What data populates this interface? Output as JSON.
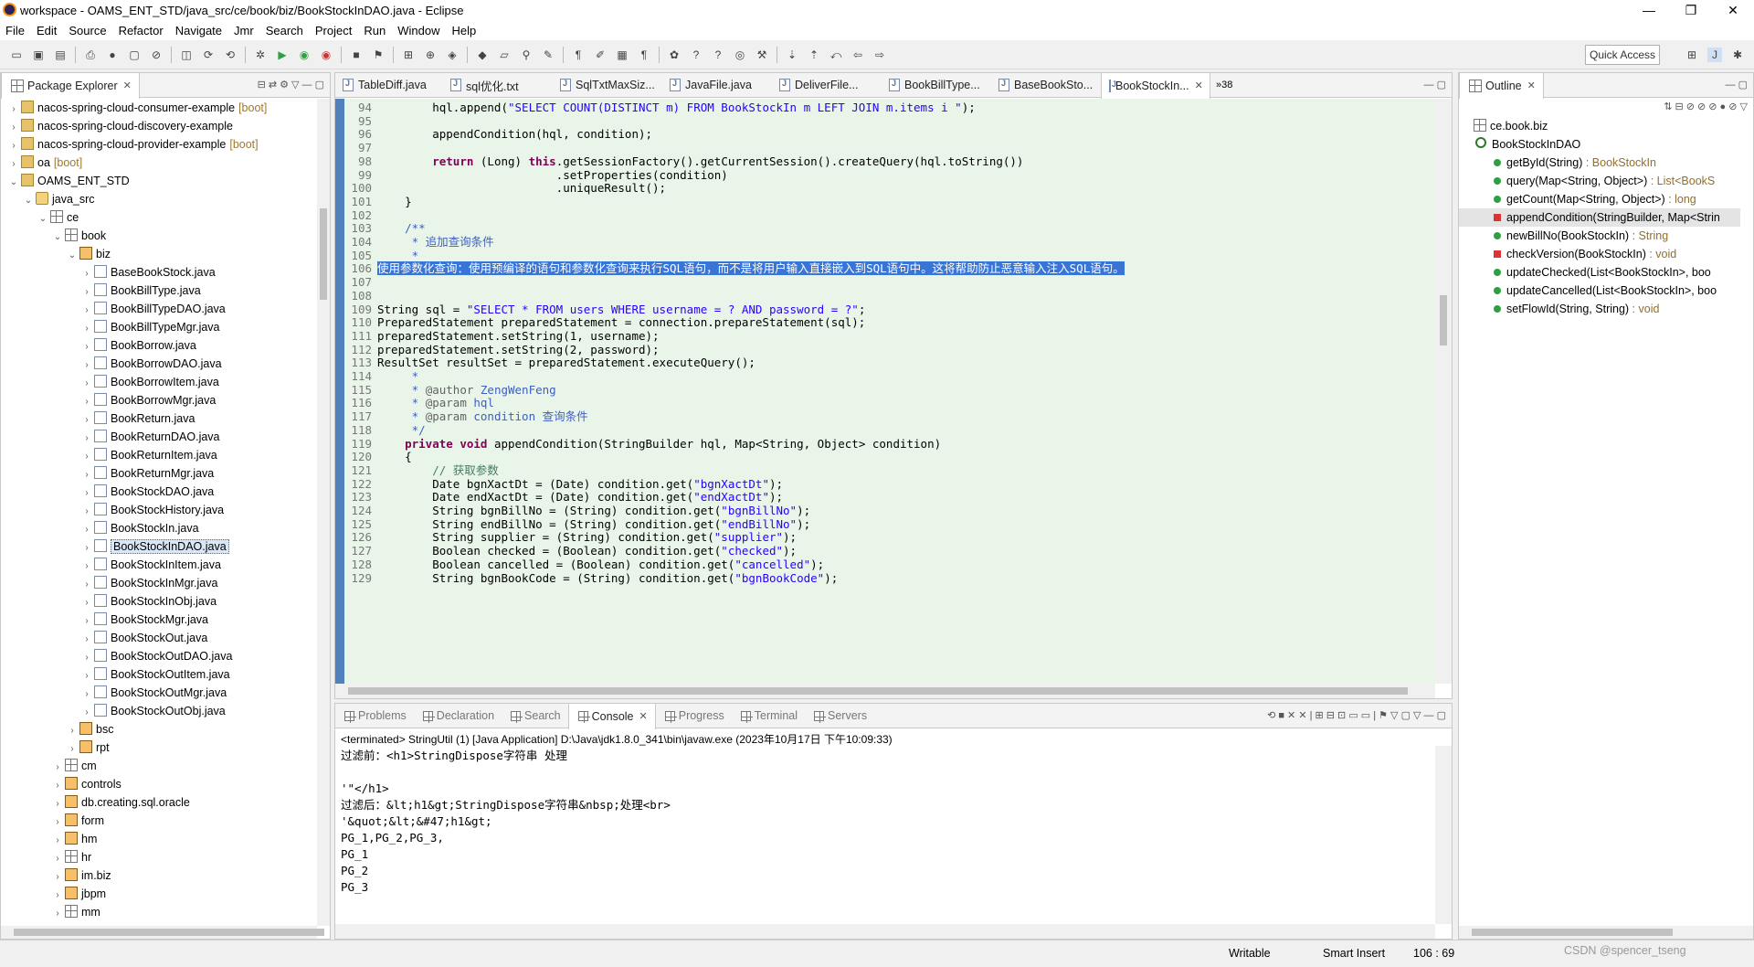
{
  "window": {
    "title": "workspace - OAMS_ENT_STD/java_src/ce/book/biz/BookStockInDAO.java - Eclipse",
    "controls": [
      "—",
      "❐",
      "✕"
    ]
  },
  "menu": [
    "File",
    "Edit",
    "Source",
    "Refactor",
    "Navigate",
    "Jmr",
    "Search",
    "Project",
    "Run",
    "Window",
    "Help"
  ],
  "toolbar": {
    "quick_access": "Quick Access"
  },
  "package_explorer": {
    "title": "Package Explorer",
    "rows": [
      {
        "label": "nacos-spring-cloud-consumer-example",
        "suffix": "[boot]",
        "depth": 0,
        "arrow": "›",
        "icon": "proj"
      },
      {
        "label": "nacos-spring-cloud-discovery-example",
        "suffix": "",
        "depth": 0,
        "arrow": "›",
        "icon": "proj"
      },
      {
        "label": "nacos-spring-cloud-provider-example",
        "suffix": "[boot]",
        "depth": 0,
        "arrow": "›",
        "icon": "proj"
      },
      {
        "label": "oa",
        "suffix": "[boot]",
        "depth": 0,
        "arrow": "›",
        "icon": "proj"
      },
      {
        "label": "OAMS_ENT_STD",
        "suffix": "",
        "depth": 0,
        "arrow": "⌄",
        "icon": "proj"
      },
      {
        "label": "java_src",
        "suffix": "",
        "depth": 1,
        "arrow": "⌄",
        "icon": "src"
      },
      {
        "label": "ce",
        "suffix": "",
        "depth": 2,
        "arrow": "⌄",
        "icon": "pk"
      },
      {
        "label": "book",
        "suffix": "",
        "depth": 3,
        "arrow": "⌄",
        "icon": "pk"
      },
      {
        "label": "biz",
        "suffix": "",
        "depth": 4,
        "arrow": "⌄",
        "icon": "pkb"
      },
      {
        "label": "BaseBookStock.java",
        "suffix": "",
        "depth": 5,
        "arrow": "›",
        "icon": "jf"
      },
      {
        "label": "BookBillType.java",
        "suffix": "",
        "depth": 5,
        "arrow": "›",
        "icon": "jf"
      },
      {
        "label": "BookBillTypeDAO.java",
        "suffix": "",
        "depth": 5,
        "arrow": "›",
        "icon": "jf"
      },
      {
        "label": "BookBillTypeMgr.java",
        "suffix": "",
        "depth": 5,
        "arrow": "›",
        "icon": "jf"
      },
      {
        "label": "BookBorrow.java",
        "suffix": "",
        "depth": 5,
        "arrow": "›",
        "icon": "jf"
      },
      {
        "label": "BookBorrowDAO.java",
        "suffix": "",
        "depth": 5,
        "arrow": "›",
        "icon": "jf"
      },
      {
        "label": "BookBorrowItem.java",
        "suffix": "",
        "depth": 5,
        "arrow": "›",
        "icon": "jf"
      },
      {
        "label": "BookBorrowMgr.java",
        "suffix": "",
        "depth": 5,
        "arrow": "›",
        "icon": "jf"
      },
      {
        "label": "BookReturn.java",
        "suffix": "",
        "depth": 5,
        "arrow": "›",
        "icon": "jf"
      },
      {
        "label": "BookReturnDAO.java",
        "suffix": "",
        "depth": 5,
        "arrow": "›",
        "icon": "jf"
      },
      {
        "label": "BookReturnItem.java",
        "suffix": "",
        "depth": 5,
        "arrow": "›",
        "icon": "jf"
      },
      {
        "label": "BookReturnMgr.java",
        "suffix": "",
        "depth": 5,
        "arrow": "›",
        "icon": "jf"
      },
      {
        "label": "BookStockDAO.java",
        "suffix": "",
        "depth": 5,
        "arrow": "›",
        "icon": "jf"
      },
      {
        "label": "BookStockHistory.java",
        "suffix": "",
        "depth": 5,
        "arrow": "›",
        "icon": "jf"
      },
      {
        "label": "BookStockIn.java",
        "suffix": "",
        "depth": 5,
        "arrow": "›",
        "icon": "jf"
      },
      {
        "label": "BookStockInDAO.java",
        "suffix": "",
        "depth": 5,
        "arrow": "›",
        "icon": "jf",
        "selected": true
      },
      {
        "label": "BookStockInItem.java",
        "suffix": "",
        "depth": 5,
        "arrow": "›",
        "icon": "jf"
      },
      {
        "label": "BookStockInMgr.java",
        "suffix": "",
        "depth": 5,
        "arrow": "›",
        "icon": "jf"
      },
      {
        "label": "BookStockInObj.java",
        "suffix": "",
        "depth": 5,
        "arrow": "›",
        "icon": "jf"
      },
      {
        "label": "BookStockMgr.java",
        "suffix": "",
        "depth": 5,
        "arrow": "›",
        "icon": "jf"
      },
      {
        "label": "BookStockOut.java",
        "suffix": "",
        "depth": 5,
        "arrow": "›",
        "icon": "jf"
      },
      {
        "label": "BookStockOutDAO.java",
        "suffix": "",
        "depth": 5,
        "arrow": "›",
        "icon": "jf"
      },
      {
        "label": "BookStockOutItem.java",
        "suffix": "",
        "depth": 5,
        "arrow": "›",
        "icon": "jf"
      },
      {
        "label": "BookStockOutMgr.java",
        "suffix": "",
        "depth": 5,
        "arrow": "›",
        "icon": "jf"
      },
      {
        "label": "BookStockOutObj.java",
        "suffix": "",
        "depth": 5,
        "arrow": "›",
        "icon": "jf"
      },
      {
        "label": "bsc",
        "suffix": "",
        "depth": 4,
        "arrow": "›",
        "icon": "pkb"
      },
      {
        "label": "rpt",
        "suffix": "",
        "depth": 4,
        "arrow": "›",
        "icon": "pkb"
      },
      {
        "label": "cm",
        "suffix": "",
        "depth": 3,
        "arrow": "›",
        "icon": "pk"
      },
      {
        "label": "controls",
        "suffix": "",
        "depth": 3,
        "arrow": "›",
        "icon": "pkb"
      },
      {
        "label": "db.creating.sql.oracle",
        "suffix": "",
        "depth": 3,
        "arrow": "›",
        "icon": "pkb"
      },
      {
        "label": "form",
        "suffix": "",
        "depth": 3,
        "arrow": "›",
        "icon": "pkb"
      },
      {
        "label": "hm",
        "suffix": "",
        "depth": 3,
        "arrow": "›",
        "icon": "pkb"
      },
      {
        "label": "hr",
        "suffix": "",
        "depth": 3,
        "arrow": "›",
        "icon": "pk"
      },
      {
        "label": "im.biz",
        "suffix": "",
        "depth": 3,
        "arrow": "›",
        "icon": "pkb"
      },
      {
        "label": "jbpm",
        "suffix": "",
        "depth": 3,
        "arrow": "›",
        "icon": "pkb"
      },
      {
        "label": "mm",
        "suffix": "",
        "depth": 3,
        "arrow": "›",
        "icon": "pk"
      }
    ]
  },
  "editor": {
    "tabs": [
      "TableDiff.java",
      "sql优化.txt",
      "SqlTxtMaxSiz...",
      "JavaFile.java",
      "DeliverFile...",
      "BookBillType...",
      "BaseBookSto...",
      "BookStockIn..."
    ],
    "active_tab": "BookStockIn...",
    "overflow": "»38",
    "lines": [
      {
        "n": "94",
        "t": "        hql.append(\"SELECT COUNT(DISTINCT m) FROM BookStockIn m LEFT JOIN m.items i \");"
      },
      {
        "n": "95",
        "t": ""
      },
      {
        "n": "96",
        "t": "        appendCondition(hql, condition);"
      },
      {
        "n": "97",
        "t": ""
      },
      {
        "n": "98",
        "t": "        return (Long) this.getSessionFactory().getCurrentSession().createQuery(hql.toString())"
      },
      {
        "n": "99",
        "t": "                          .setProperties(condition)"
      },
      {
        "n": "100",
        "t": "                          .uniqueResult();"
      },
      {
        "n": "101",
        "t": "    }"
      },
      {
        "n": "102",
        "t": ""
      },
      {
        "n": "103",
        "t": "    /**"
      },
      {
        "n": "104",
        "t": "     * 追加查询条件"
      },
      {
        "n": "105",
        "t": "     *"
      },
      {
        "n": "106",
        "t": "使用参数化查询：使用预编译的语句和参数化查询来执行SQL语句，而不是将用户输入直接嵌入到SQL语句中。这将帮助防止恶意输入注入SQL语句。",
        "hl": true
      },
      {
        "n": "107",
        "t": ""
      },
      {
        "n": "108",
        "t": ""
      },
      {
        "n": "109",
        "t": "String sql = \"SELECT * FROM users WHERE username = ? AND password = ?\";"
      },
      {
        "n": "110",
        "t": "PreparedStatement preparedStatement = connection.prepareStatement(sql);"
      },
      {
        "n": "111",
        "t": "preparedStatement.setString(1, username);"
      },
      {
        "n": "112",
        "t": "preparedStatement.setString(2, password);"
      },
      {
        "n": "113",
        "t": "ResultSet resultSet = preparedStatement.executeQuery();"
      },
      {
        "n": "114",
        "t": "     *"
      },
      {
        "n": "115",
        "t": "     * @author ZengWenFeng"
      },
      {
        "n": "116",
        "t": "     * @param hql"
      },
      {
        "n": "117",
        "t": "     * @param condition 查询条件"
      },
      {
        "n": "118",
        "t": "     */"
      },
      {
        "n": "119",
        "t": "    private void appendCondition(StringBuilder hql, Map<String, Object> condition)"
      },
      {
        "n": "120",
        "t": "    {"
      },
      {
        "n": "121",
        "t": "        // 获取参数"
      },
      {
        "n": "122",
        "t": "        Date bgnXactDt = (Date) condition.get(\"bgnXactDt\");"
      },
      {
        "n": "123",
        "t": "        Date endXactDt = (Date) condition.get(\"endXactDt\");"
      },
      {
        "n": "124",
        "t": "        String bgnBillNo = (String) condition.get(\"bgnBillNo\");"
      },
      {
        "n": "125",
        "t": "        String endBillNo = (String) condition.get(\"endBillNo\");"
      },
      {
        "n": "126",
        "t": "        String supplier = (String) condition.get(\"supplier\");"
      },
      {
        "n": "127",
        "t": "        Boolean checked = (Boolean) condition.get(\"checked\");"
      },
      {
        "n": "128",
        "t": "        Boolean cancelled = (Boolean) condition.get(\"cancelled\");"
      },
      {
        "n": "129",
        "t": "        String bgnBookCode = (String) condition.get(\"bgnBookCode\");"
      }
    ]
  },
  "outline": {
    "title": "Outline",
    "rows": [
      {
        "label": "ce.book.biz",
        "type": "",
        "kind": "pkg",
        "depth": 0
      },
      {
        "label": "BookStockInDAO",
        "type": "",
        "kind": "class",
        "depth": 0
      },
      {
        "label": "getById(String)",
        "type": " : BookStockIn",
        "kind": "pub",
        "depth": 1
      },
      {
        "label": "query(Map<String, Object>)",
        "type": " : List<BookS",
        "kind": "pub",
        "depth": 1
      },
      {
        "label": "getCount(Map<String, Object>)",
        "type": " : long",
        "kind": "pub",
        "depth": 1
      },
      {
        "label": "appendCondition(StringBuilder, Map<Strin",
        "type": "",
        "kind": "priv",
        "depth": 1,
        "selected": true
      },
      {
        "label": "newBillNo(BookStockIn)",
        "type": " : String",
        "kind": "pub",
        "depth": 1
      },
      {
        "label": "checkVersion(BookStockIn)",
        "type": " : void",
        "kind": "priv",
        "depth": 1
      },
      {
        "label": "updateChecked(List<BookStockIn>, boo",
        "type": "",
        "kind": "pub",
        "depth": 1
      },
      {
        "label": "updateCancelled(List<BookStockIn>, boo",
        "type": "",
        "kind": "pub",
        "depth": 1
      },
      {
        "label": "setFlowId(String, String)",
        "type": " : void",
        "kind": "pub",
        "depth": 1
      }
    ]
  },
  "console": {
    "tabs": [
      "Problems",
      "Declaration",
      "Search",
      "Console",
      "Progress",
      "Terminal",
      "Servers"
    ],
    "active_tab": "Console",
    "terminated": "<terminated> StringUtil (1) [Java Application] D:\\Java\\jdk1.8.0_341\\bin\\javaw.exe (2023年10月17日 下午10:09:33)",
    "lines": [
      "过滤前：<h1>StringDispose字符串 处理",
      "",
      "'\"</h1>",
      "过滤后：&lt;h1&gt;StringDispose字符串&nbsp;处理<br>",
      "'&quot;&lt;&#47;h1&gt;",
      "PG_1,PG_2,PG_3,",
      "PG_1",
      "PG_2",
      "PG_3"
    ]
  },
  "status": {
    "writable": "Writable",
    "insert": "Smart Insert",
    "position": "106 : 69",
    "watermark": "CSDN @spencer_tseng"
  }
}
